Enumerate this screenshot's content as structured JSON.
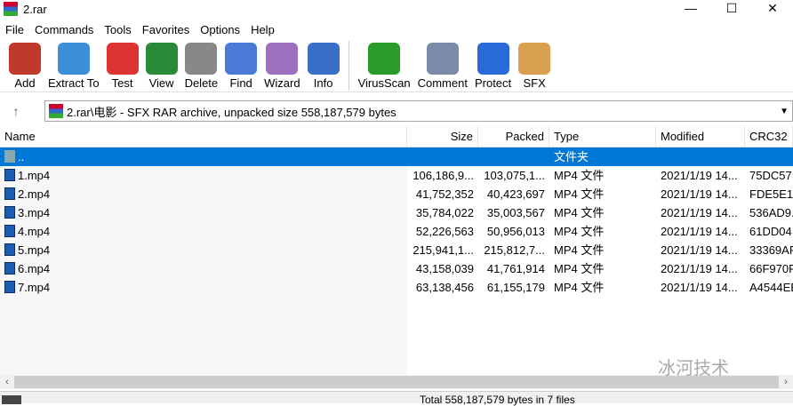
{
  "window": {
    "title": "2.rar"
  },
  "menu": [
    "File",
    "Commands",
    "Tools",
    "Favorites",
    "Options",
    "Help"
  ],
  "toolbar": [
    {
      "label": "Add",
      "icon": "add-icon",
      "color": "#c0392b"
    },
    {
      "label": "Extract To",
      "icon": "extract-folder-icon",
      "color": "#3a8fd8"
    },
    {
      "label": "Test",
      "icon": "test-clipboard-icon",
      "color": "#d33"
    },
    {
      "label": "View",
      "icon": "book-icon",
      "color": "#2a8a3a"
    },
    {
      "label": "Delete",
      "icon": "trash-icon",
      "color": "#888"
    },
    {
      "label": "Find",
      "icon": "magnifier-icon",
      "color": "#4a7ad8"
    },
    {
      "label": "Wizard",
      "icon": "wand-icon",
      "color": "#a070c0"
    },
    {
      "label": "Info",
      "icon": "info-icon",
      "color": "#3a6fc8"
    },
    {
      "label": "VirusScan",
      "icon": "virus-icon",
      "color": "#2a9a2a"
    },
    {
      "label": "Comment",
      "icon": "comment-icon",
      "color": "#7a8aa8"
    },
    {
      "label": "Protect",
      "icon": "shield-icon",
      "color": "#2a6ad8"
    },
    {
      "label": "SFX",
      "icon": "sfx-box-icon",
      "color": "#d8a050"
    }
  ],
  "address": {
    "path": "2.rar\\电影 - SFX RAR archive, unpacked size 558,187,579 bytes"
  },
  "columns": {
    "name": "Name",
    "size": "Size",
    "packed": "Packed",
    "type": "Type",
    "modified": "Modified",
    "crc": "CRC32"
  },
  "parent": {
    "name": "..",
    "type": "文件夹"
  },
  "files": [
    {
      "name": "1.mp4",
      "size": "106,186,9...",
      "packed": "103,075,1...",
      "type": "MP4 文件",
      "modified": "2021/1/19 14...",
      "crc": "75DC57..."
    },
    {
      "name": "2.mp4",
      "size": "41,752,352",
      "packed": "40,423,697",
      "type": "MP4 文件",
      "modified": "2021/1/19 14...",
      "crc": "FDE5E11"
    },
    {
      "name": "3.mp4",
      "size": "35,784,022",
      "packed": "35,003,567",
      "type": "MP4 文件",
      "modified": "2021/1/19 14...",
      "crc": "536AD9..."
    },
    {
      "name": "4.mp4",
      "size": "52,226,563",
      "packed": "50,956,013",
      "type": "MP4 文件",
      "modified": "2021/1/19 14...",
      "crc": "61DD04..."
    },
    {
      "name": "5.mp4",
      "size": "215,941,1...",
      "packed": "215,812,7...",
      "type": "MP4 文件",
      "modified": "2021/1/19 14...",
      "crc": "33369AF"
    },
    {
      "name": "6.mp4",
      "size": "43,158,039",
      "packed": "41,761,914",
      "type": "MP4 文件",
      "modified": "2021/1/19 14...",
      "crc": "66F970F"
    },
    {
      "name": "7.mp4",
      "size": "63,138,456",
      "packed": "61,155,179",
      "type": "MP4 文件",
      "modified": "2021/1/19 14...",
      "crc": "A4544EE"
    }
  ],
  "status": {
    "text": "Total 558,187,579 bytes in 7 files"
  },
  "watermark": "冰河技术"
}
